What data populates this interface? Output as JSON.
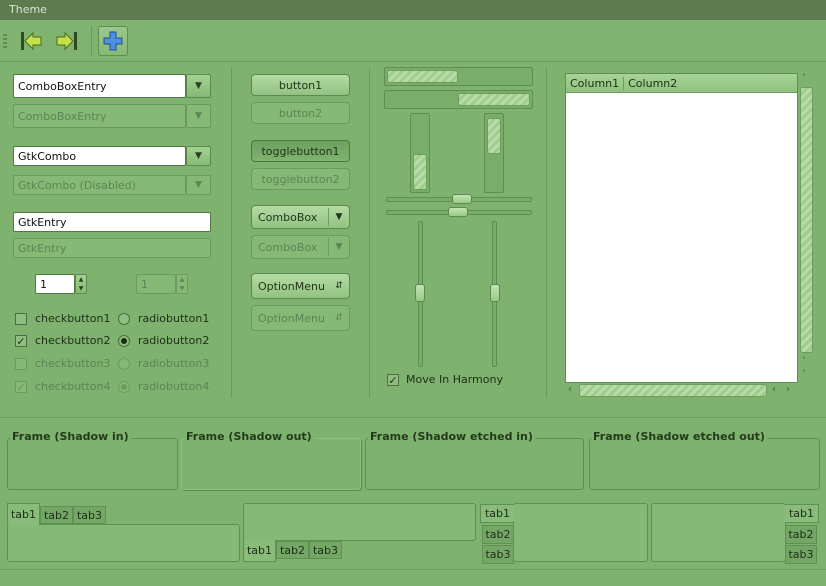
{
  "window": {
    "title": "Theme"
  },
  "toolbar": {
    "items": [
      {
        "icon": "go-first-icon"
      },
      {
        "icon": "go-last-icon"
      },
      {
        "icon": "add-icon"
      }
    ]
  },
  "left": {
    "comboboxentry": {
      "value": "ComboBoxEntry"
    },
    "comboboxentry_disabled": {
      "value": "ComboBoxEntry"
    },
    "gtkcombo": {
      "value": "GtkCombo"
    },
    "gtkcombo_disabled": {
      "value": "GtkCombo (Disabled)"
    },
    "entry": {
      "value": "GtkEntry"
    },
    "entry_disabled": {
      "value": "GtkEntry"
    },
    "spin": {
      "value": "1"
    },
    "spin_disabled": {
      "value": "1"
    },
    "checks": [
      {
        "label": "checkbutton1",
        "checked": false
      },
      {
        "label": "checkbutton2",
        "checked": true
      },
      {
        "label": "checkbutton3",
        "checked": false
      },
      {
        "label": "checkbutton4",
        "checked": true
      }
    ],
    "radios": [
      {
        "label": "radiobutton1",
        "checked": false
      },
      {
        "label": "radiobutton2",
        "checked": true
      },
      {
        "label": "radiobutton3",
        "checked": false
      },
      {
        "label": "radiobutton4",
        "checked": true
      }
    ]
  },
  "middle": {
    "button1": "button1",
    "button2": "button2",
    "toggle1": "togglebutton1",
    "toggle2": "togglebutton2",
    "combobox1": "ComboBox",
    "combobox2": "ComboBox",
    "option1": "OptionMenu",
    "option2": "OptionMenu"
  },
  "ranges": {
    "move_in_harmony": {
      "label": "Move In Harmony",
      "checked": true
    }
  },
  "tree": {
    "columns": [
      "Column1",
      "Column2"
    ]
  },
  "frames": [
    {
      "label": "Frame (Shadow in)"
    },
    {
      "label": "Frame (Shadow out)"
    },
    {
      "label": "Frame (Shadow etched in)"
    },
    {
      "label": "Frame (Shadow etched out)"
    }
  ],
  "notebooks": [
    {
      "tabs": [
        "tab1",
        "tab2",
        "tab3"
      ],
      "position": "top"
    },
    {
      "tabs": [
        "tab1",
        "tab2",
        "tab3"
      ],
      "position": "bottom"
    },
    {
      "tabs": [
        "tab1",
        "tab2",
        "tab3"
      ],
      "position": "left"
    },
    {
      "tabs": [
        "tab1",
        "tab2",
        "tab3"
      ],
      "position": "right"
    }
  ],
  "colors": {
    "background": "#7fb26f",
    "titlebar": "#5e7b4f",
    "accent_blue": "#3a7bd5"
  }
}
